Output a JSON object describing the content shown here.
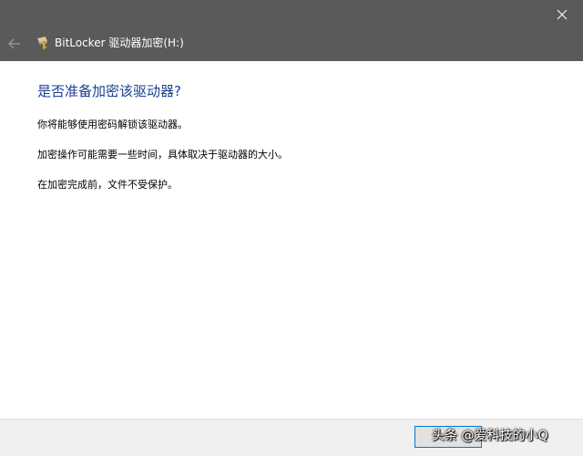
{
  "window": {
    "title": "BitLocker 驱动器加密(H:)"
  },
  "content": {
    "heading": "是否准备加密该驱动器?",
    "paragraphs": [
      "你将能够使用密码解锁该驱动器。",
      "加密操作可能需要一些时间，具体取决于驱动器的大小。",
      "在加密完成前，文件不受保护。"
    ]
  },
  "footer": {
    "button_label": "",
    "watermark": "头条 @爱科技的小Q"
  },
  "colors": {
    "titlebar": "#5a5a5a",
    "heading": "#1c3f94",
    "footer": "#f0f0f0",
    "button_border": "#0078d7"
  },
  "icons": {
    "close": "close-icon",
    "back": "back-arrow-icon",
    "app": "bitlocker-icon"
  }
}
